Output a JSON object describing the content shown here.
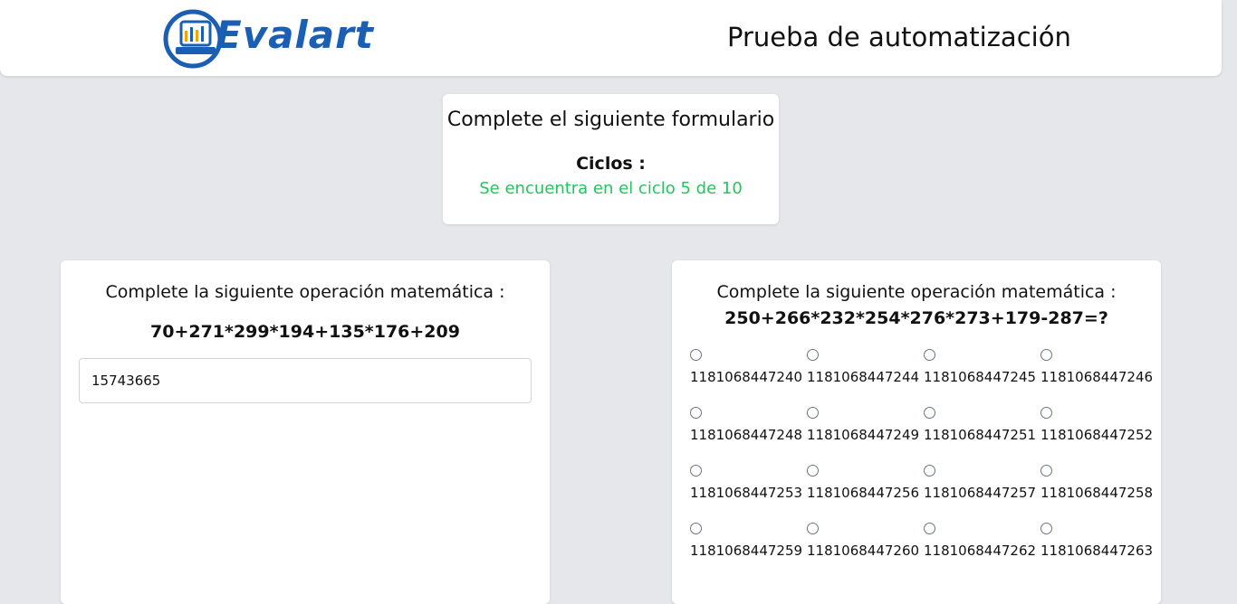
{
  "header": {
    "logo_text": "Evalart",
    "title": "Prueba de automatización"
  },
  "status": {
    "title": "Complete el siguiente formulario",
    "cycles_label": "Ciclos :",
    "cycles_status": "Se encuentra en el ciclo 5 de 10"
  },
  "left_card": {
    "heading": "Complete la siguiente operación matemática :",
    "expression": "70+271*299*194+135*176+209",
    "answer_value": "15743665"
  },
  "right_card": {
    "heading": "Complete la siguiente operación matemática :",
    "expression": "250+266*232*254*276*273+179-287=?",
    "options": [
      "1181068447240",
      "1181068447244",
      "1181068447245",
      "1181068447246",
      "1181068447248",
      "1181068447249",
      "1181068447251",
      "1181068447252",
      "1181068447253",
      "1181068447256",
      "1181068447257",
      "1181068447258",
      "1181068447259",
      "1181068447260",
      "1181068447262",
      "1181068447263"
    ]
  },
  "colors": {
    "background": "#e5e7eb",
    "brand_blue": "#1a5fb4",
    "status_green": "#22c55e"
  }
}
